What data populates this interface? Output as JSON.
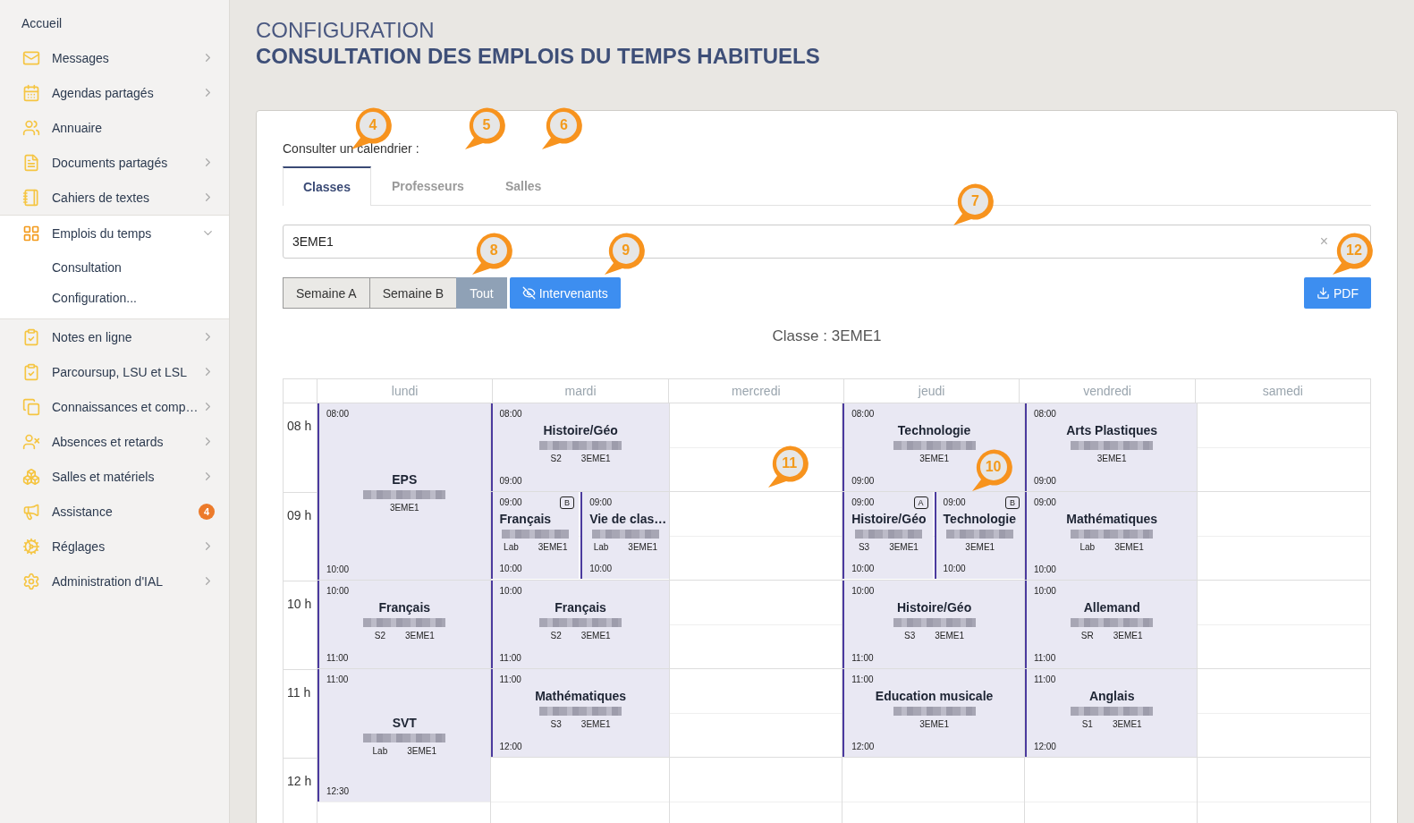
{
  "sidebar": {
    "items": [
      {
        "label": "Accueil"
      },
      {
        "label": "Messages",
        "expanded": false
      },
      {
        "label": "Agendas partagés",
        "expanded": false
      },
      {
        "label": "Annuaire"
      },
      {
        "label": "Documents partagés",
        "expanded": false
      },
      {
        "label": "Cahiers de textes",
        "expanded": false
      },
      {
        "label": "Emplois du temps",
        "expanded": true,
        "children": [
          {
            "label": "Consultation"
          },
          {
            "label": "Configuration..."
          }
        ]
      },
      {
        "label": "Notes en ligne",
        "expanded": false
      },
      {
        "label": "Parcoursup, LSU et LSL",
        "expanded": false
      },
      {
        "label": "Connaissances et comp…",
        "expanded": false
      },
      {
        "label": "Absences et retards",
        "expanded": false
      },
      {
        "label": "Salles et matériels",
        "expanded": false
      },
      {
        "label": "Assistance",
        "badge": "4"
      },
      {
        "label": "Réglages",
        "expanded": false
      },
      {
        "label": "Administration d'IAL",
        "expanded": false
      }
    ]
  },
  "header": {
    "section": "CONFIGURATION",
    "title": "CONSULTATION DES EMPLOIS DU TEMPS HABITUELS"
  },
  "calendar_picker": {
    "label": "Consulter un calendrier :",
    "tabs": [
      {
        "label": "Classes",
        "selected": true,
        "callout": "4"
      },
      {
        "label": "Professeurs",
        "selected": false,
        "callout": "5"
      },
      {
        "label": "Salles",
        "selected": false,
        "callout": "6"
      }
    ]
  },
  "search": {
    "value": "3EME1",
    "clear": "×",
    "callout": "7"
  },
  "week_buttons": [
    {
      "label": "Semaine A",
      "selected": false
    },
    {
      "label": "Semaine B",
      "selected": false
    },
    {
      "label": "Tout",
      "selected": true,
      "callout": "8"
    }
  ],
  "intervenants_button": {
    "label": "Intervenants",
    "callout": "9"
  },
  "pdf_button": {
    "label": "PDF",
    "callout": "12"
  },
  "timetable": {
    "caption": "Classe : 3EME1",
    "hours": [
      "08 h",
      "09 h",
      "10 h",
      "11 h",
      "12 h"
    ],
    "days": [
      {
        "name": "lundi",
        "lessons": [
          {
            "kind": "single",
            "start": "08:00",
            "end": "10:00",
            "subject": "EPS",
            "class": "3EME1"
          },
          {
            "kind": "single",
            "start": "10:00",
            "end": "11:00",
            "subject": "Français",
            "room": "S2",
            "class": "3EME1"
          },
          {
            "kind": "single",
            "start": "11:00",
            "end": "12:30",
            "subject": "SVT",
            "room": "Lab",
            "class": "3EME1"
          }
        ]
      },
      {
        "name": "mardi",
        "lessons": [
          {
            "kind": "single",
            "start": "08:00",
            "end": "09:00",
            "subject": "Histoire/Géo",
            "room": "S2",
            "class": "3EME1"
          },
          {
            "kind": "split",
            "parts": [
              {
                "start": "09:00",
                "end": "10:00",
                "subject": "Français",
                "room": "Lab",
                "class": "3EME1",
                "week": "B"
              },
              {
                "start": "09:00",
                "end": "10:00",
                "subject": "Vie de clas…",
                "room": "Lab",
                "class": "3EME1"
              }
            ]
          },
          {
            "kind": "single",
            "start": "10:00",
            "end": "11:00",
            "subject": "Français",
            "room": "S2",
            "class": "3EME1"
          },
          {
            "kind": "single",
            "start": "11:00",
            "end": "12:00",
            "subject": "Mathématiques",
            "room": "S3",
            "class": "3EME1"
          }
        ]
      },
      {
        "name": "mercredi",
        "callout": "11"
      },
      {
        "name": "jeudi",
        "lessons": [
          {
            "kind": "single",
            "start": "08:00",
            "end": "09:00",
            "subject": "Technologie",
            "class": "3EME1"
          },
          {
            "kind": "split",
            "parts": [
              {
                "start": "09:00",
                "end": "10:00",
                "subject": "Histoire/Géo",
                "room": "S3",
                "class": "3EME1",
                "week": "A"
              },
              {
                "start": "09:00",
                "end": "10:00",
                "subject": "Technologie",
                "class": "3EME1",
                "week": "B",
                "callout": "10"
              }
            ]
          },
          {
            "kind": "single",
            "start": "10:00",
            "end": "11:00",
            "subject": "Histoire/Géo",
            "room": "S3",
            "class": "3EME1"
          },
          {
            "kind": "single",
            "start": "11:00",
            "end": "12:00",
            "subject": "Education musicale",
            "class": "3EME1"
          }
        ]
      },
      {
        "name": "vendredi",
        "lessons": [
          {
            "kind": "single",
            "start": "08:00",
            "end": "09:00",
            "subject": "Arts Plastiques",
            "class": "3EME1"
          },
          {
            "kind": "single",
            "start": "09:00",
            "end": "10:00",
            "subject": "Mathématiques",
            "room": "Lab",
            "class": "3EME1"
          },
          {
            "kind": "single",
            "start": "10:00",
            "end": "11:00",
            "subject": "Allemand",
            "room": "SR",
            "class": "3EME1"
          },
          {
            "kind": "single",
            "start": "11:00",
            "end": "12:00",
            "subject": "Anglais",
            "room": "S1",
            "class": "3EME1"
          }
        ]
      },
      {
        "name": "samedi"
      }
    ]
  }
}
